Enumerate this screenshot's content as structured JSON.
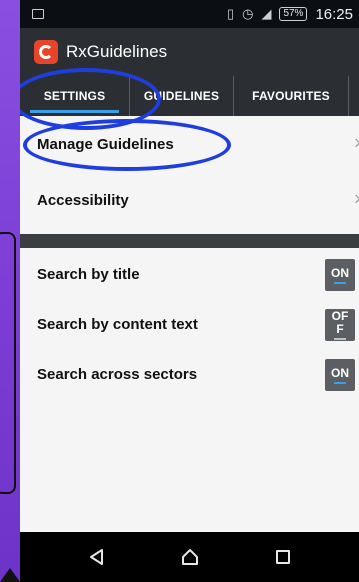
{
  "status_bar": {
    "battery": "57%",
    "time": "16:25"
  },
  "app_bar": {
    "title": "RxGuidelines"
  },
  "tabs": [
    {
      "label": "SETTINGS",
      "active": true
    },
    {
      "label": "GUIDELINES",
      "active": false
    },
    {
      "label": "FAVOURITES",
      "active": false
    }
  ],
  "menu": {
    "items": [
      {
        "label": "Manage Guidelines"
      },
      {
        "label": "Accessibility"
      }
    ]
  },
  "toggles": [
    {
      "label": "Search by title",
      "state": "ON"
    },
    {
      "label": "Search by content text",
      "state": "OF\nF"
    },
    {
      "label": "Search across sectors",
      "state": "ON"
    }
  ],
  "colors": {
    "annotation": "#1f3ee0",
    "accent": "#3aa0e8",
    "app_bar": "#2b2f33",
    "logo": "#e8442a",
    "background": "#7c3ed6"
  }
}
